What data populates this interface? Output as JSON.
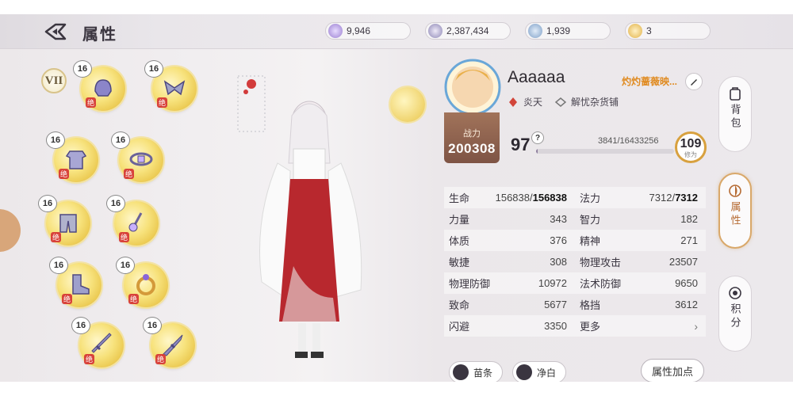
{
  "header": {
    "title": "属性",
    "currencies": [
      {
        "icon": "purple-gem-icon",
        "value": "9,946",
        "color": "#9b7fd1"
      },
      {
        "icon": "silver-coin-icon",
        "value": "2,387,434",
        "color": "#8d86b5"
      },
      {
        "icon": "blue-token-icon",
        "value": "1,939",
        "color": "#7fa0c8"
      },
      {
        "icon": "gold-coin-icon",
        "value": "3",
        "color": "#e2b24a"
      }
    ]
  },
  "equipment": {
    "rank": "VII",
    "slots": [
      {
        "level": "16",
        "tag": "绝",
        "item": "helmet-icon"
      },
      {
        "level": "16",
        "tag": "绝",
        "item": "shoulder-icon"
      },
      {
        "level": "16",
        "tag": "绝",
        "item": "armor-icon"
      },
      {
        "level": "16",
        "tag": "绝",
        "item": "belt-icon"
      },
      {
        "level": "16",
        "tag": "绝",
        "item": "pants-icon"
      },
      {
        "level": "16",
        "tag": "绝",
        "item": "amulet-icon"
      },
      {
        "level": "16",
        "tag": "绝",
        "item": "boots-icon"
      },
      {
        "level": "16",
        "tag": "绝",
        "item": "ring-icon"
      },
      {
        "level": "16",
        "tag": "绝",
        "item": "weapon-left-icon"
      },
      {
        "level": "16",
        "tag": "绝",
        "item": "weapon-right-icon"
      }
    ]
  },
  "player": {
    "name": "Aaaaaa",
    "title": "灼灼蔷薇映...",
    "faction": "炎天",
    "guild": "解忧杂货铺",
    "power_label": "战力",
    "power": "200308",
    "level": "97",
    "exp_text": "3841/16433256",
    "exp_fraction": 0.0002,
    "cultivation": "109",
    "cultivation_label": "修为"
  },
  "stats": [
    {
      "left_label": "生命",
      "left_value": "156838/",
      "left_bold": "156838",
      "right_label": "法力",
      "right_value": "7312/",
      "right_bold": "7312"
    },
    {
      "left_label": "力量",
      "left_value": "343",
      "left_bold": "",
      "right_label": "智力",
      "right_value": "182",
      "right_bold": ""
    },
    {
      "left_label": "体质",
      "left_value": "376",
      "left_bold": "",
      "right_label": "精神",
      "right_value": "271",
      "right_bold": ""
    },
    {
      "left_label": "敏捷",
      "left_value": "308",
      "left_bold": "",
      "right_label": "物理攻击",
      "right_value": "23507",
      "right_bold": ""
    },
    {
      "left_label": "物理防御",
      "left_value": "10972",
      "left_bold": "",
      "right_label": "法术防御",
      "right_value": "9650",
      "right_bold": ""
    },
    {
      "left_label": "致命",
      "left_value": "5677",
      "left_bold": "",
      "right_label": "格挡",
      "right_value": "3612",
      "right_bold": ""
    },
    {
      "left_label": "闪避",
      "left_value": "3350",
      "left_bold": "",
      "right_label": "更多",
      "right_value": "",
      "right_bold": ""
    }
  ],
  "buttons": {
    "miaotiao": "苗条",
    "jingbai": "净白",
    "attr_points": "属性加点"
  },
  "side_tabs": [
    {
      "label": "背包",
      "icon": "backpack-icon"
    },
    {
      "label": "属性",
      "icon": "attribute-icon"
    },
    {
      "label": "积分",
      "icon": "points-icon"
    }
  ]
}
